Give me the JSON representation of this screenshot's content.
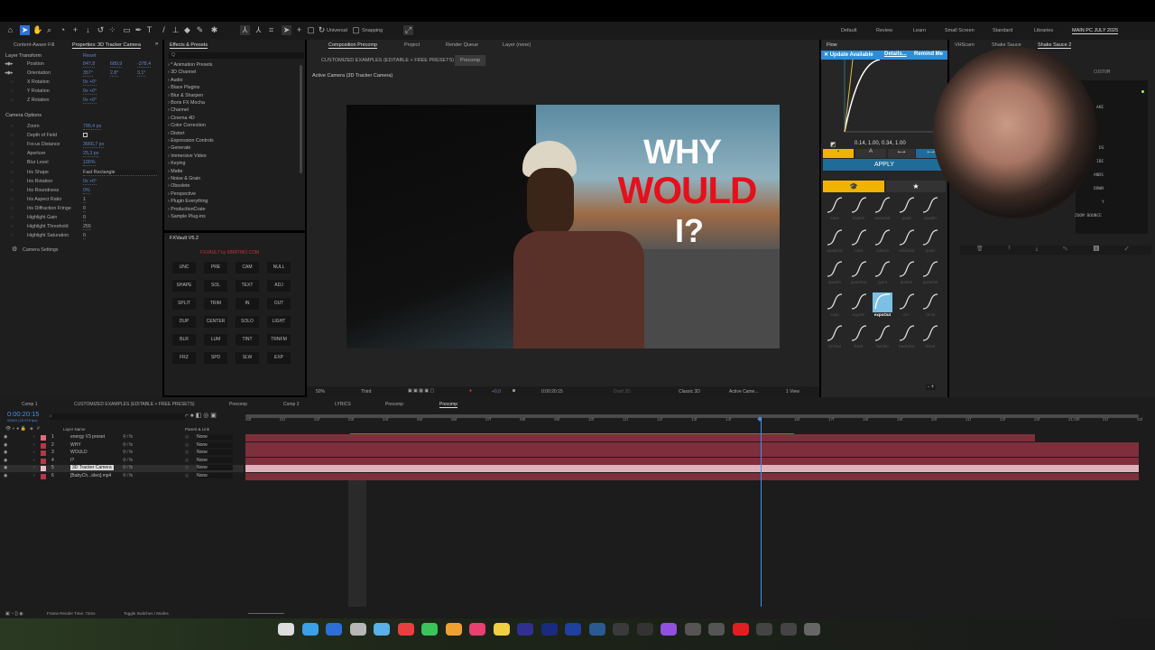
{
  "toolbar": {
    "universal_label": "Universal",
    "snapping_label": "Snapping"
  },
  "workspaces": [
    "Default",
    "Review",
    "Learn",
    "Small Screen",
    "Standard",
    "Libraries",
    "MAIN PC JULY 2025"
  ],
  "properties": {
    "tab_caf": "Content-Aware Fill",
    "tab_props": "Properties: 3D Tracker Camera",
    "layer_transform": "Layer Transform",
    "reset": "Reset",
    "transform_rows": [
      {
        "label": "Position",
        "values": [
          "847,8",
          "689,9",
          "-378,4"
        ]
      },
      {
        "label": "Orientation",
        "values": [
          "357°",
          "2,8°",
          "3,1°"
        ]
      },
      {
        "label": "X Rotation",
        "values": [
          "0x +0°"
        ]
      },
      {
        "label": "Y Rotation",
        "values": [
          "0x +0°"
        ]
      },
      {
        "label": "Z Rotation",
        "values": [
          "0x +0°"
        ]
      }
    ],
    "camera_options": "Camera Options",
    "camera_rows": [
      {
        "label": "Zoom",
        "value": "799,4 px"
      },
      {
        "label": "Depth of Field",
        "value": ""
      },
      {
        "label": "Focus Distance",
        "value": "3666,7 px"
      },
      {
        "label": "Aperture",
        "value": "25,3 px"
      },
      {
        "label": "Blur Level",
        "value": "100%"
      },
      {
        "label": "Iris Shape",
        "value": "Fast Rectangle"
      },
      {
        "label": "Iris Rotation",
        "value": "0x +0°"
      },
      {
        "label": "Iris Roundness",
        "value": "0%"
      },
      {
        "label": "Iris Aspect Ratio",
        "value": "1"
      },
      {
        "label": "Iris Diffraction Fringe",
        "value": "0"
      },
      {
        "label": "Highlight Gain",
        "value": "0"
      },
      {
        "label": "Highlight Threshold",
        "value": "255"
      },
      {
        "label": "Highlight Saturation",
        "value": "0"
      }
    ],
    "camera_settings": "Camera Settings"
  },
  "effects": {
    "title": "Effects & Presets",
    "search_placeholder": "Q",
    "items": [
      "* Animation Presets",
      "3D Channel",
      "Audio",
      "Blace Plugins",
      "Blur & Sharpen",
      "Boris FX Mocha",
      "Channel",
      "Cinema 4D",
      "Color Correction",
      "Distort",
      "Expression Controls",
      "Generate",
      "Immersive Video",
      "Keying",
      "Matte",
      "Noise & Grain",
      "Obsolete",
      "Perspective",
      "Plugin Everything",
      "ProductionCrate",
      "Sample Plug-ins"
    ]
  },
  "fxvault": {
    "title": "FXVault V5.2",
    "credit": "FXVAULT by MNRTMO.COM",
    "buttons": [
      "UNC",
      "PRE",
      "CAM",
      "NULL",
      "SHAPE",
      "SOL",
      "TEXT",
      "ADJ",
      "SPLIT",
      "TRIM",
      "IN",
      "OUT",
      "DUP",
      "CENTER",
      "SOLO",
      "LIGHT",
      "BLR",
      "LUM",
      "TINT",
      "TRNFM",
      "FRZ",
      "SPD",
      "SLW",
      "EXP"
    ]
  },
  "composition": {
    "tab": "Composition Precomp",
    "tab_project": "Project",
    "tab_render": "Render Queue",
    "tab_layer": "Layer (none)",
    "crumb_parent": "CUSTOMIZED EXAMPLES (EDITABLE + FREE PRESETS)",
    "crumb_current": "Precomp",
    "camera_label": "Active Camera (3D Tracker Camera)",
    "overlay_line1": "WHY",
    "overlay_line2": "WOULD",
    "overlay_line3": "I?",
    "footer": {
      "zoom": "50%",
      "resolution": "Third",
      "exposure": "+0,0",
      "timecode": "0:00:20:15",
      "draft3d": "Draft 3D",
      "renderer": "Classic 3D",
      "camera": "Active Came...",
      "views": "1 View"
    }
  },
  "flow": {
    "title": "Flow",
    "update": "✕ Update Available",
    "details": "Details...",
    "remind": "Remind Me",
    "bezier": "0.14, 1.00, 0.34, 1.00",
    "apply": "APPLY",
    "eases": [
      "ease",
      "easeIn",
      "easeOut",
      "quad",
      "quadIn",
      "quadOut",
      "cubic",
      "cubicIn",
      "cubicOut",
      "quart",
      "quartIn",
      "quartOut",
      "quint",
      "quintIn",
      "quintOut",
      "expo",
      "expoIn",
      "expoOut",
      "circ",
      "circIn",
      "circOut",
      "back",
      "backIn",
      "backOut",
      "linear"
    ],
    "selected": "expoOut",
    "accent": "#f0b400"
  },
  "shake": {
    "tabs": [
      "VHScam",
      "Shake Sauce",
      "Shake Sauce 2"
    ],
    "custom": "CUSTOM",
    "items": [
      "AKE",
      "DS",
      "IDE",
      "ANDS",
      "DOWN",
      "Y",
      "ZOOM BOUNCE"
    ]
  },
  "timeline": {
    "tabs": [
      "Comp 1",
      "CUSTOMIZED EXAMPLES (EDITABLE + FREE PRESETS)",
      "Precomp",
      "Comp 2",
      "LYRICS",
      "Precomp",
      "Precomp"
    ],
    "timecode": "0:00:20:15",
    "frames": "00515 (23.976 fps)",
    "col_layer_name": "Layer Name",
    "col_parent": "Parent & Link",
    "layers": [
      {
        "num": "1",
        "name": "energy V3 preset",
        "parent": "None",
        "color": "#e06a7e"
      },
      {
        "num": "2",
        "name": "WHY",
        "parent": "None",
        "color": "#b03a48"
      },
      {
        "num": "3",
        "name": "WOULD",
        "parent": "None",
        "color": "#b03a48"
      },
      {
        "num": "4",
        "name": "I?",
        "parent": "None",
        "color": "#b03a48"
      },
      {
        "num": "5",
        "name": "3D Tracker Camera",
        "parent": "None",
        "color": "#e8c0c8"
      },
      {
        "num": "6",
        "name": "[BabyCh...ideo].mp4",
        "parent": "None",
        "color": "#b03a48"
      }
    ],
    "ruler": [
      "00f",
      "01f",
      "02f",
      "03f",
      "04f",
      "05f",
      "06f",
      "07f",
      "08f",
      "09f",
      "10f",
      "11f",
      "12f",
      "13f",
      "14f",
      "15f",
      "16f",
      "17f",
      "18f",
      "19f",
      "20f",
      "21f",
      "22f",
      "23f",
      "21:00f",
      "01f",
      "02f"
    ],
    "playhead_fraction": 0.577,
    "frame_render_time": "Frame Render Time:  72ms",
    "toggle": "Toggle Switches / Modes"
  }
}
